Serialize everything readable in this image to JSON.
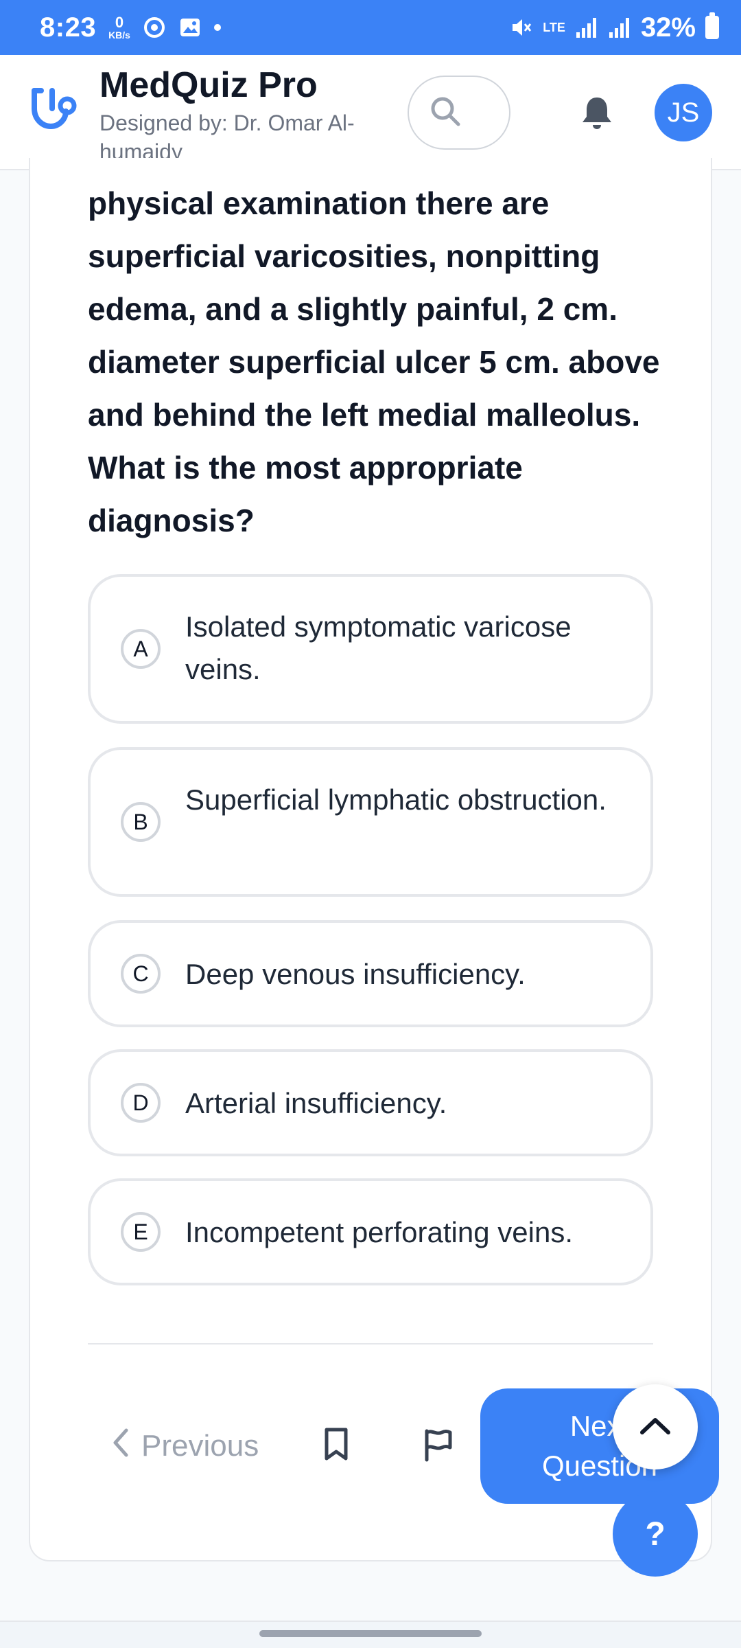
{
  "status_bar": {
    "time": "8:23",
    "net_speed": "0",
    "net_unit": "KB/s",
    "network": "LTE",
    "battery": "32%"
  },
  "header": {
    "app_title": "MedQuiz Pro",
    "subtitle": "Designed by: Dr. Omar Al-humaidy",
    "avatar_initials": "JS",
    "accent_color": "#3b82f6"
  },
  "question": {
    "text": "physical examination there are superficial varicosities, nonpitting edema, and a slightly painful, 2 cm. diameter superficial ulcer 5 cm. above and behind the left medial malleolus. What is the most appropriate diagnosis?"
  },
  "options": [
    {
      "letter": "A",
      "text": "Isolated symptomatic varicose veins."
    },
    {
      "letter": "B",
      "text": "Superficial lymphatic obstruction."
    },
    {
      "letter": "C",
      "text": "Deep venous insufficiency."
    },
    {
      "letter": "D",
      "text": "Arterial insufficiency."
    },
    {
      "letter": "E",
      "text": "Incompetent perforating veins."
    }
  ],
  "nav": {
    "previous_label": "Previous",
    "next_label_line1": "Next",
    "next_label_line2": "Question",
    "help_label": "?"
  },
  "icons": {
    "logo": "stethoscope-icon",
    "search": "search-icon",
    "notifications": "bell-icon",
    "bookmark": "bookmark-icon",
    "flag": "flag-icon",
    "previous": "chevron-left-icon",
    "scroll_top": "chevron-up-icon"
  }
}
